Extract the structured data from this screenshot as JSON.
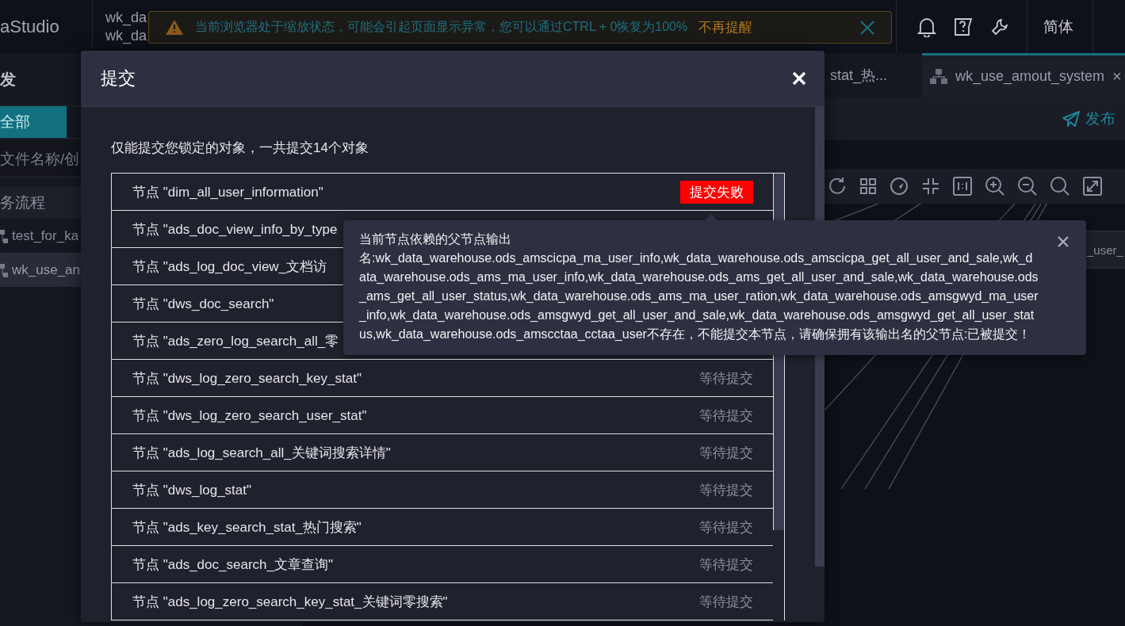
{
  "top_bar": {
    "logo_text": "aStudio",
    "workspace_lines": [
      "wk_da",
      "wk_da"
    ],
    "language": "简体"
  },
  "zoom_warning": {
    "message": "当前浏览器处于缩放状态，可能会引起页面显示异常，您可以通过CTRL + 0恢复为100%",
    "dismiss_link": "不再提醒"
  },
  "sidebar": {
    "title": "发",
    "filter_tabs": [
      {
        "label": "全部",
        "selected": true
      }
    ],
    "search": {
      "placeholder": "文件名称/创"
    },
    "section": "务流程",
    "items": [
      {
        "label": "test_for_ka",
        "selected": false
      },
      {
        "label": "wk_use_an",
        "selected": true
      }
    ]
  },
  "editor_tabs": [
    {
      "label": "stat_热...",
      "selected": false
    },
    {
      "label": "wk_use_amout_system",
      "selected": true,
      "close_label": "×"
    }
  ],
  "publish_button": "发布",
  "canvas": {
    "nodes": [
      {
        "label": "_user_"
      }
    ]
  },
  "dialog": {
    "title": "提交",
    "description": "仅能提交您锁定的对象，一共提交14个对象",
    "rows": [
      {
        "name": "节点 \"dim_all_user_information\"",
        "status": {
          "kind": "failed",
          "label": "提交失败"
        }
      },
      {
        "name": "节点 \"ads_doc_view_info_by_type"
      },
      {
        "name": "节点 \"ads_log_doc_view_文档访"
      },
      {
        "name": "节点 \"dws_doc_search\""
      },
      {
        "name": "节点 \"ads_zero_log_search_all_零"
      },
      {
        "name": "节点 \"dws_log_zero_search_key_stat\"",
        "status": {
          "kind": "pending",
          "label": "等待提交"
        }
      },
      {
        "name": "节点 \"dws_log_zero_search_user_stat\"",
        "status": {
          "kind": "pending",
          "label": "等待提交"
        }
      },
      {
        "name": "节点 \"ads_log_search_all_关键词搜索详情\"",
        "status": {
          "kind": "pending",
          "label": "等待提交"
        }
      },
      {
        "name": "节点 \"dws_log_stat\"",
        "status": {
          "kind": "pending",
          "label": "等待提交"
        }
      },
      {
        "name": "节点 \"ads_key_search_stat_热门搜索\"",
        "status": {
          "kind": "pending",
          "label": "等待提交"
        }
      },
      {
        "name": "节点 \"ads_doc_search_文章查询\"",
        "status": {
          "kind": "pending",
          "label": "等待提交"
        }
      },
      {
        "name": "节点 \"ads_log_zero_search_key_stat_关键词零搜索\"",
        "status": {
          "kind": "pending",
          "label": "等待提交"
        }
      }
    ]
  },
  "error_popover": {
    "text": "当前节点依赖的父节点输出名:wk_data_warehouse.ods_amscicpa_ma_user_info,wk_data_warehouse.ods_amscicpa_get_all_user_and_sale,wk_data_warehouse.ods_ams_ma_user_info,wk_data_warehouse.ods_ams_get_all_user_and_sale,wk_data_warehouse.ods_ams_get_all_user_status,wk_data_warehouse.ods_ams_ma_user_ration,wk_data_warehouse.ods_amsgwyd_ma_user_info,wk_data_warehouse.ods_amsgwyd_get_all_user_and_sale,wk_data_warehouse.ods_amsgwyd_get_all_user_status,wk_data_warehouse.ods_amscctaa_cctaa_user不存在，不能提交本节点，请确保拥有该输出名的父节点:已被提交！"
  }
}
